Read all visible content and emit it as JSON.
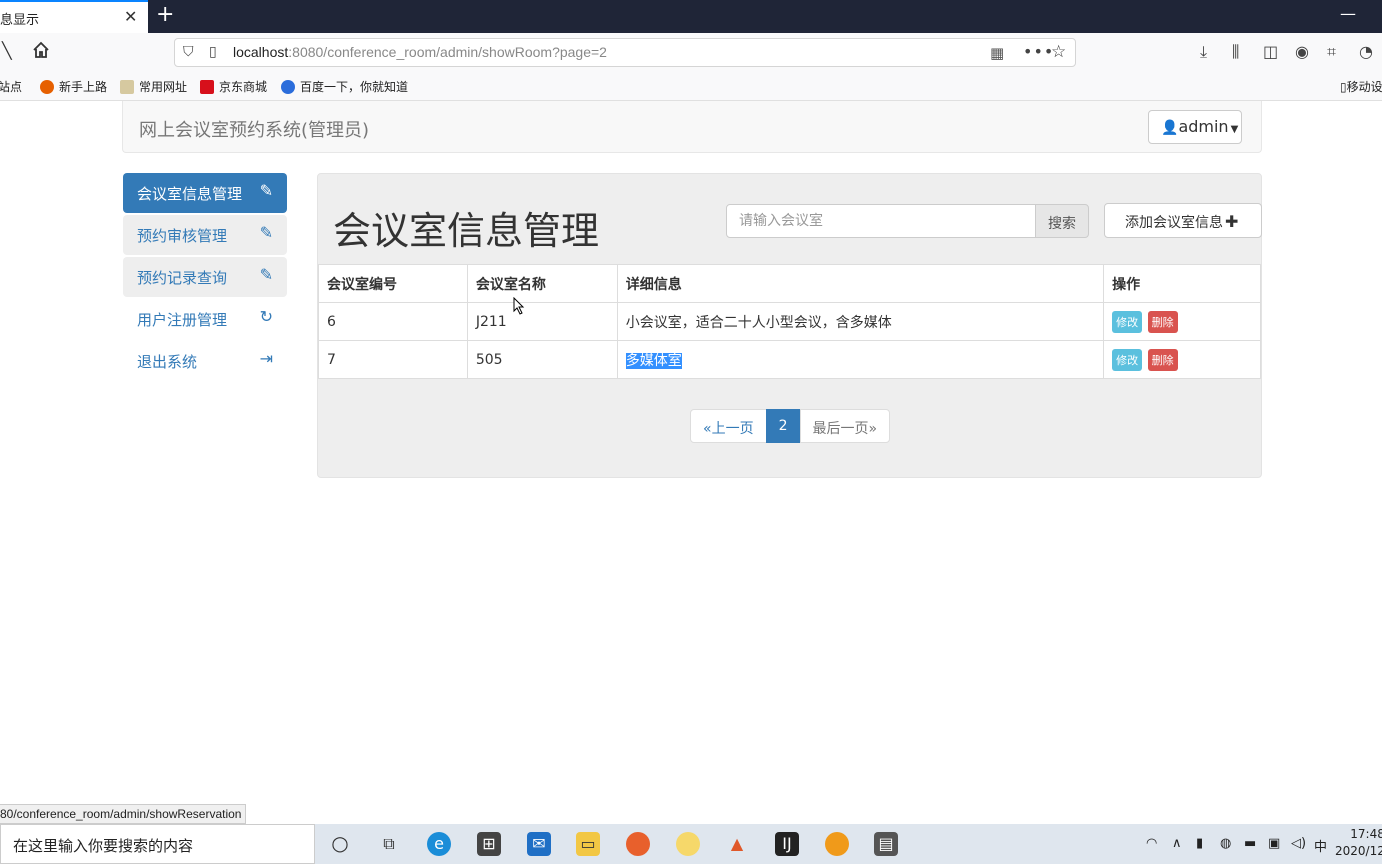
{
  "browser": {
    "tab_title": "息显示",
    "tab_close": "✕",
    "new_tab": "+",
    "minimize": "—",
    "url_host": "localhost",
    "url_rest": ":8080/conference_room/admin/showRoom?page=2",
    "bookmarks": [
      "站点",
      "新手上路",
      "常用网址",
      "京东商城",
      "百度一下，你就知道",
      "移动设"
    ]
  },
  "app": {
    "brand": "网上会议室预约系统(管理员)",
    "user_menu": "admin"
  },
  "sidebar": {
    "items": [
      {
        "label": "会议室信息管理",
        "icon": "pencil-icon",
        "state": "active"
      },
      {
        "label": "预约审核管理",
        "icon": "pencil-icon",
        "state": "gray"
      },
      {
        "label": "预约记录查询",
        "icon": "pencil-icon",
        "state": "gray"
      },
      {
        "label": "用户注册管理",
        "icon": "refresh-icon",
        "state": "link"
      },
      {
        "label": "退出系统",
        "icon": "logout-icon",
        "state": "link"
      }
    ]
  },
  "main": {
    "title": "会议室信息管理",
    "search_placeholder": "请输入会议室",
    "search_button": "搜索",
    "add_button": "添加会议室信息",
    "table": {
      "headers": [
        "会议室编号",
        "会议室名称",
        "详细信息",
        "操作"
      ],
      "rows": [
        {
          "id": "6",
          "name": "J211",
          "detail": "小会议室，适合二十人小型会议，含多媒体"
        },
        {
          "id": "7",
          "name": "505",
          "detail": "多媒体室"
        }
      ],
      "edit_label": "修改",
      "delete_label": "删除"
    },
    "pager": {
      "prev": "«上一页",
      "current": "2",
      "last": "最后一页»"
    }
  },
  "status_url": "80/conference_room/admin/showReservation",
  "taskbar": {
    "search_text": "在这里输入你要搜索的内容",
    "ime": "中",
    "time": "17:48",
    "date": "2020/12"
  }
}
